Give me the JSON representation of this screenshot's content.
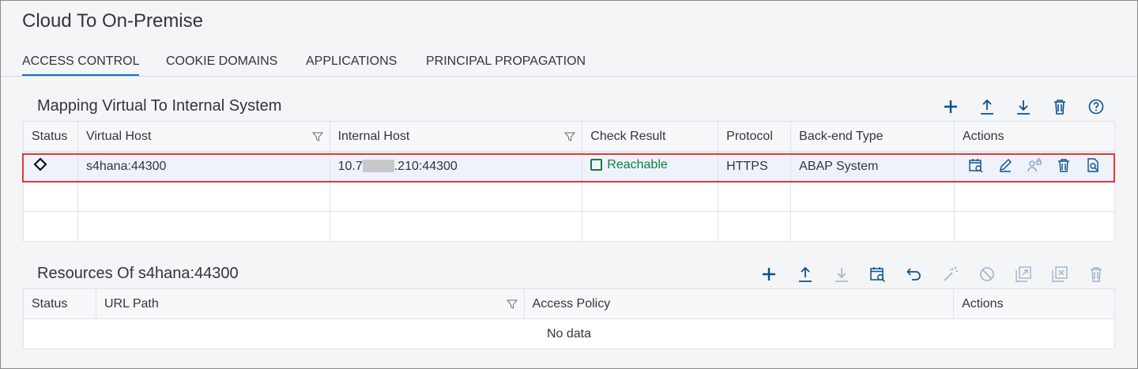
{
  "page": {
    "title": "Cloud To On-Premise"
  },
  "tabs": [
    {
      "label": "ACCESS CONTROL",
      "active": true
    },
    {
      "label": "COOKIE DOMAINS",
      "active": false
    },
    {
      "label": "APPLICATIONS",
      "active": false
    },
    {
      "label": "PRINCIPAL PROPAGATION",
      "active": false
    }
  ],
  "mapping": {
    "title": "Mapping Virtual To Internal System",
    "toolbar_icons": [
      "add-icon",
      "upload-icon",
      "download-icon",
      "delete-icon",
      "help-icon"
    ],
    "columns": [
      "Status",
      "Virtual Host",
      "Internal Host",
      "Check Result",
      "Protocol",
      "Back-end Type",
      "Actions"
    ],
    "rows": [
      {
        "status_icon": "diamond-icon",
        "virtual_host": "s4hana:44300",
        "internal_host_prefix": "10.7",
        "internal_host_suffix": ".210:44300",
        "check_result": "Reachable",
        "protocol": "HTTPS",
        "backend_type": "ABAP System",
        "actions": [
          "check-availability-icon",
          "edit-icon",
          "principal-type-icon",
          "delete-icon",
          "view-icon"
        ]
      }
    ]
  },
  "resources": {
    "title": "Resources Of s4hana:44300",
    "toolbar_icons": [
      "add-icon",
      "upload-icon",
      "download-icon",
      "check-availability-icon",
      "undo-icon",
      "magic-wand-icon",
      "disable-icon",
      "enable-icon",
      "remove-icon",
      "delete-icon"
    ],
    "columns": [
      "Status",
      "URL Path",
      "Access Policy",
      "Actions"
    ],
    "empty_text": "No data"
  },
  "colors": {
    "accent": "#0a6ed1",
    "positive": "#107e3e",
    "highlight_border": "#e53935",
    "icon": "#0a4f8c"
  }
}
